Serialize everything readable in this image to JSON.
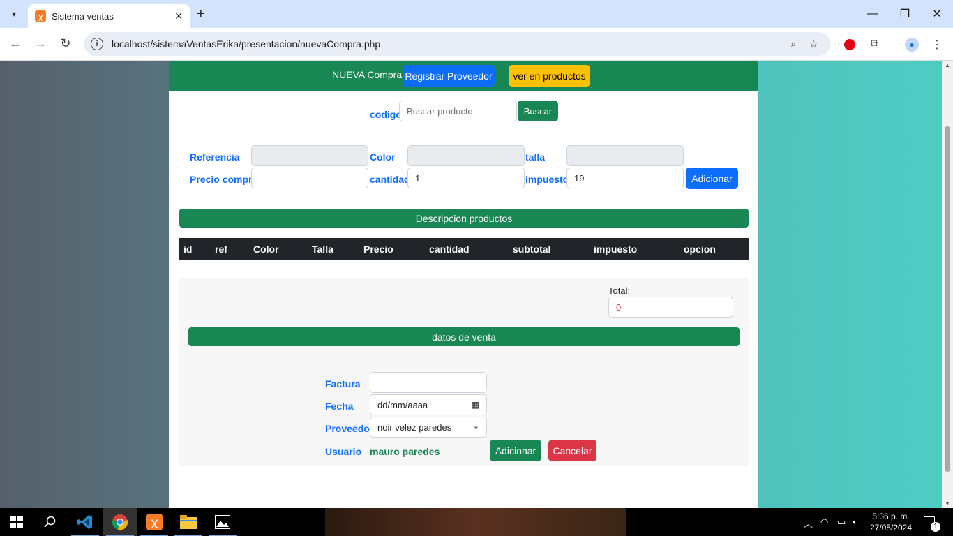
{
  "browser": {
    "tab_title": "Sistema ventas",
    "url": "localhost/sistemaVentasErika/presentacion/nuevaCompra.php"
  },
  "header": {
    "title": "NUEVA Compra",
    "register_supplier": "Registrar Proveedor",
    "view_products": "ver en productos"
  },
  "search": {
    "label": "codigo",
    "placeholder": "Buscar producto",
    "button": "Buscar"
  },
  "product_form": {
    "reference_label": "Referencia",
    "color_label": "Color",
    "size_label": "talla",
    "price_label": "Precio compra",
    "quantity_label": "cantidad",
    "quantity_value": "1",
    "tax_label": "impuesto",
    "tax_value": "19",
    "add_button": "Adicionar"
  },
  "products_section": {
    "title": "Descripcion productos",
    "columns": [
      "id",
      "ref",
      "Color",
      "Talla",
      "Precio",
      "cantidad",
      "subtotal",
      "impuesto",
      "opcion"
    ]
  },
  "total": {
    "label": "Total:",
    "value": "0"
  },
  "sale_section": {
    "title": "datos de venta",
    "invoice_label": "Factura",
    "date_label": "Fecha",
    "date_placeholder": "dd/mm/aaaa",
    "supplier_label": "Proveedor",
    "supplier_value": "noir velez paredes",
    "user_label": "Usuario",
    "user_value": "mauro paredes",
    "add_button": "Adicionar",
    "cancel_button": "Cancelar"
  },
  "taskbar": {
    "time": "5:36 p. m.",
    "date": "27/05/2024",
    "notification_count": "1"
  },
  "colors": {
    "green": "#198754",
    "blue": "#0d6efd",
    "yellow": "#ffc107",
    "red": "#dc3545"
  }
}
